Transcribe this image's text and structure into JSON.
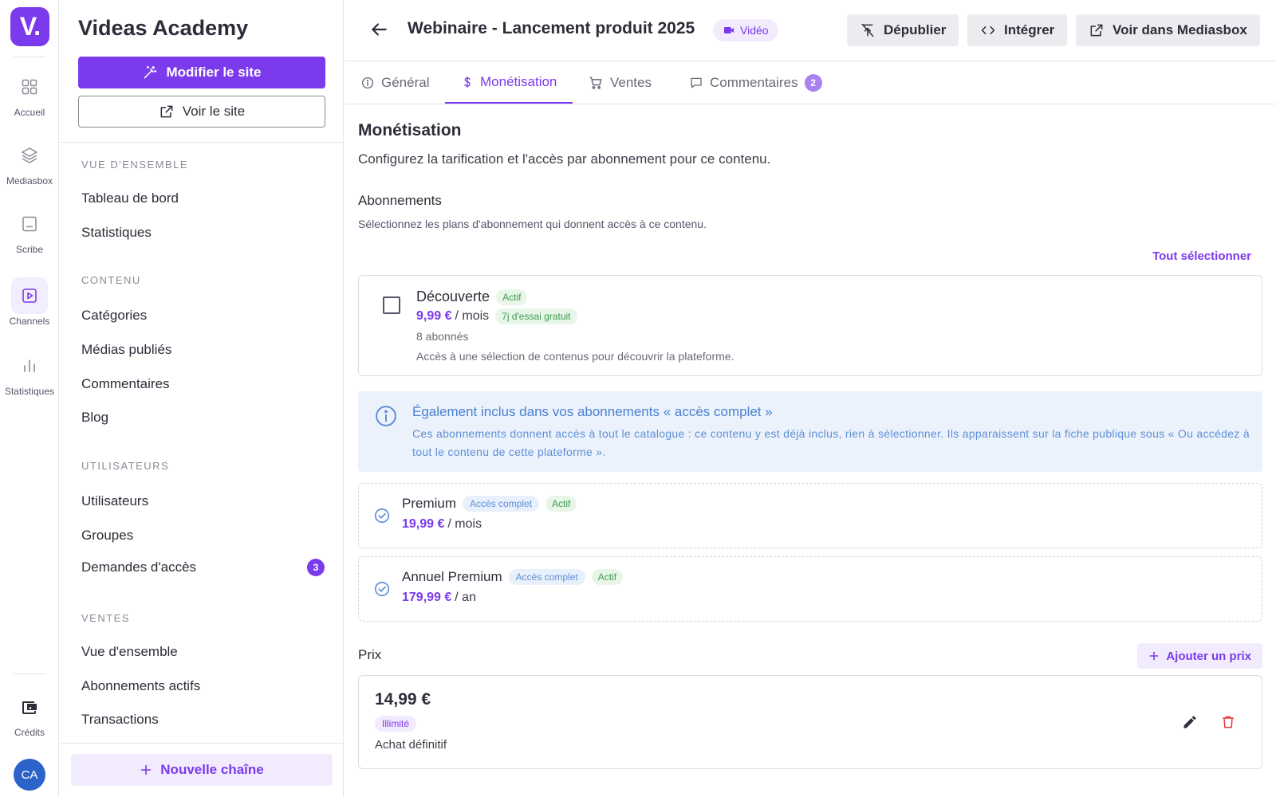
{
  "rail": {
    "logo": "V.",
    "items": [
      {
        "label": "Accueil",
        "icon": "grid-icon"
      },
      {
        "label": "Mediasbox",
        "icon": "layers-icon"
      },
      {
        "label": "Scribe",
        "icon": "scribe-icon"
      },
      {
        "label": "Channels",
        "icon": "play-square-icon",
        "active": true
      },
      {
        "label": "Statistiques",
        "icon": "bar-chart-icon"
      }
    ],
    "credits_label": "Crédits",
    "avatar": "CA"
  },
  "sidebar": {
    "title": "Videas Academy",
    "edit_site": "Modifier le site",
    "view_site": "Voir le site",
    "sections": [
      {
        "label": "VUE D'ENSEMBLE",
        "items": [
          "Tableau de bord",
          "Statistiques"
        ]
      },
      {
        "label": "CONTENU",
        "items": [
          "Catégories",
          "Médias publiés",
          "Commentaires",
          "Blog"
        ]
      },
      {
        "label": "UTILISATEURS",
        "items": [
          "Utilisateurs",
          "Groupes",
          "Demandes d'accès"
        ]
      },
      {
        "label": "VENTES",
        "items": [
          "Vue d'ensemble",
          "Abonnements actifs",
          "Transactions"
        ]
      }
    ],
    "access_requests_count": "3",
    "new_channel": "Nouvelle chaîne"
  },
  "header": {
    "title": "Webinaire - Lancement produit 2025",
    "badge": "Vidéo",
    "unpublish": "Dépublier",
    "embed": "Intégrer",
    "view_mediasbox": "Voir dans Mediasbox"
  },
  "tabs": [
    {
      "label": "Général"
    },
    {
      "label": "Monétisation",
      "active": true
    },
    {
      "label": "Ventes"
    },
    {
      "label": "Commentaires",
      "count": "2"
    }
  ],
  "monetisation": {
    "title": "Monétisation",
    "description": "Configurez la tarification et l'accès par abonnement pour ce contenu.",
    "subscriptions_title": "Abonnements",
    "subscriptions_sub": "Sélectionnez les plans d'abonnement qui donnent accès à ce contenu.",
    "select_all": "Tout sélectionner",
    "plan": {
      "name": "Découverte",
      "status": "Actif",
      "price": "9,99 €",
      "period": "/ mois",
      "trial": "7j d'essai gratuit",
      "subscribers": "8 abonnés",
      "desc": "Accès à une sélection de contenus pour découvrir la plateforme."
    },
    "info": {
      "title": "Également inclus dans vos abonnements « accès complet »",
      "text": "Ces abonnements donnent accès à tout le catalogue : ce contenu y est déjà inclus, rien à sélectionner. Ils apparaissent sur la fiche publique sous « Ou accédez à tout le contenu de cette plateforme »."
    },
    "included": [
      {
        "name": "Premium",
        "access": "Accès complet",
        "status": "Actif",
        "price": "19,99 €",
        "period": "/ mois"
      },
      {
        "name": "Annuel Premium",
        "access": "Accès complet",
        "status": "Actif",
        "price": "179,99 €",
        "period": "/ an"
      }
    ],
    "prices_title": "Prix",
    "add_price": "Ajouter un prix",
    "price_item": {
      "amount": "14,99 €",
      "tag": "Illimité",
      "type": "Achat définitif"
    }
  },
  "colors": {
    "accent": "#7c3aed",
    "info": "#5f8fd6",
    "success": "#3c9a4c",
    "danger": "#e53935"
  }
}
